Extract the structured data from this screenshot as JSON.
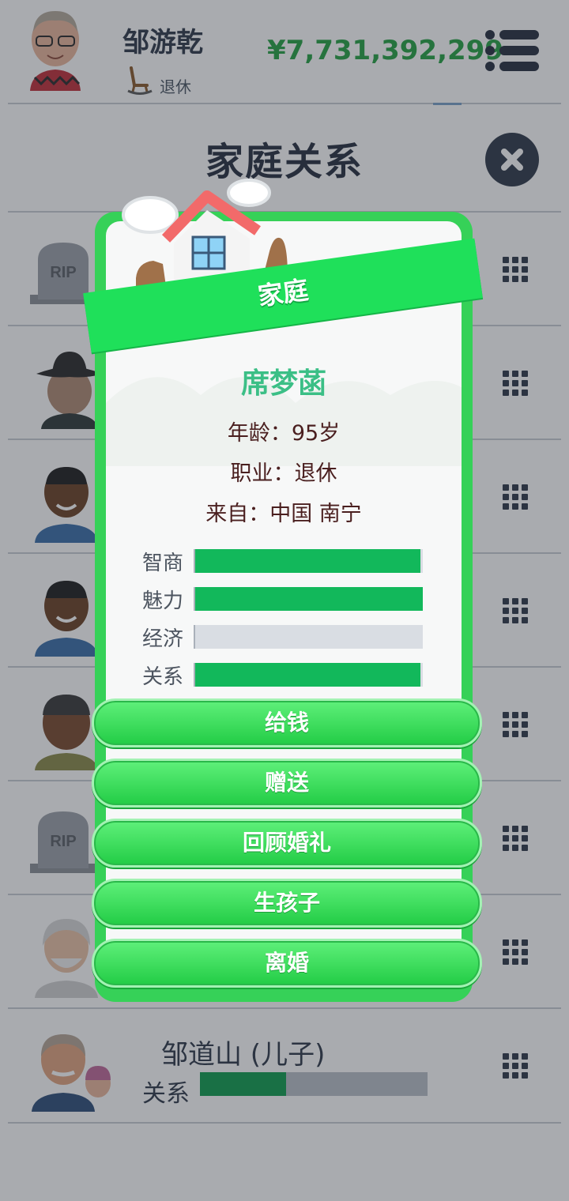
{
  "header": {
    "player_name": "邹游乾",
    "status": "退休",
    "money": "¥7,731,392,299"
  },
  "page": {
    "title": "家庭关系"
  },
  "family_list": [
    {
      "type": "deceased"
    },
    {
      "type": "person"
    },
    {
      "type": "person"
    },
    {
      "type": "person"
    },
    {
      "type": "person"
    },
    {
      "type": "deceased"
    },
    {
      "type": "person"
    },
    {
      "type": "person",
      "name": "邹道山 (儿子)",
      "relation_label": "关系",
      "relation_value": 0.38
    }
  ],
  "modal": {
    "banner": "家庭",
    "name": "席梦菡",
    "age_label": "年龄：",
    "age_value": "95岁",
    "job_label": "职业：",
    "job_value": "退休",
    "from_label": "来自：",
    "from_value": "中国 南宁",
    "stats": [
      {
        "label": "智商",
        "value": 0.99
      },
      {
        "label": "魅力",
        "value": 1.0
      },
      {
        "label": "经济",
        "value": 0.0
      },
      {
        "label": "关系",
        "value": 0.99
      }
    ],
    "actions": [
      "给钱",
      "赠送",
      "回顾婚礼",
      "生孩子",
      "离婚"
    ]
  },
  "colors": {
    "money": "#25a244",
    "accent_green": "#36d158",
    "bar_fill": "#12b85b",
    "name_teal": "#3bbf86"
  },
  "icons": {
    "menu": "hamburger-menu-icon",
    "close": "close-icon",
    "row_action": "grid-icon",
    "status": "rocking-chair-icon"
  }
}
